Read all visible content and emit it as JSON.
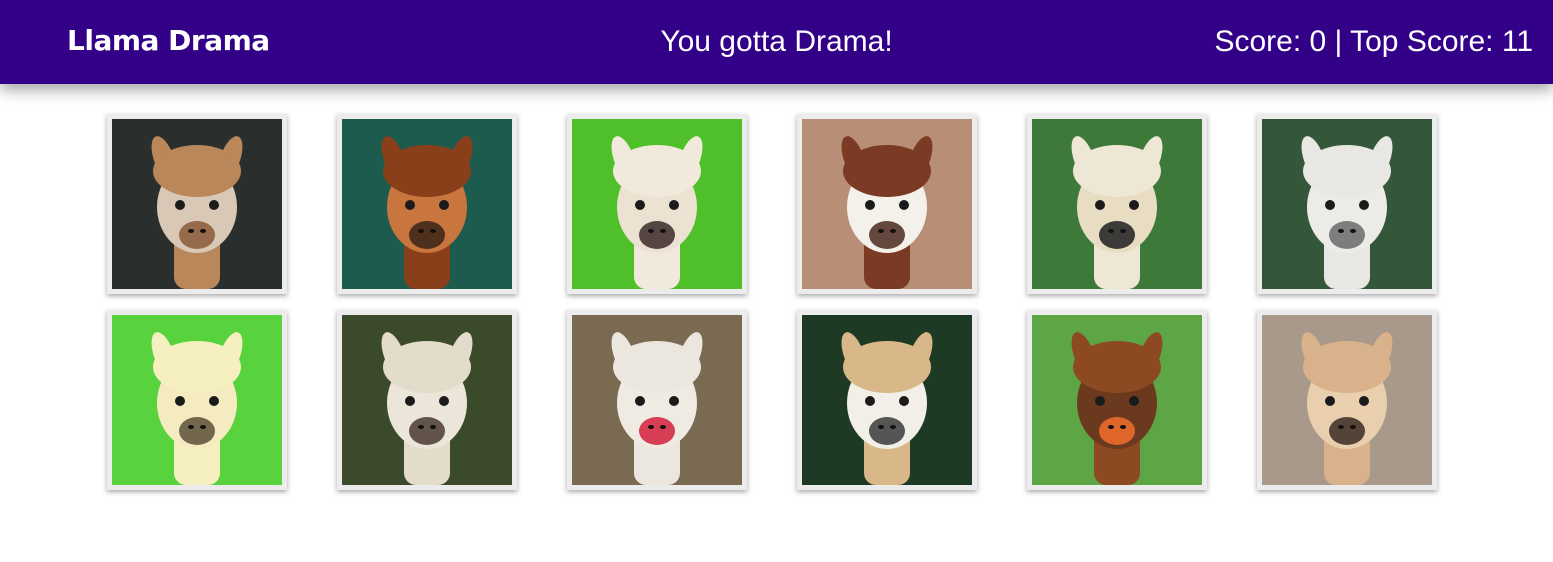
{
  "navbar": {
    "brand": "Llama Drama",
    "message": "You gotta Drama!",
    "score_label": "Score: 0 | Top Score: 11"
  },
  "cards": [
    {
      "name": "llama-card-1",
      "bg": "#2a2f2d",
      "wool": "#b9875a",
      "face": "#d8c8b5",
      "accent": "#8a5a38"
    },
    {
      "name": "llama-card-2",
      "bg": "#1d5b4e",
      "wool": "#8a3f1b",
      "face": "#c8763e",
      "accent": "#3a2418"
    },
    {
      "name": "llama-card-3",
      "bg": "#4fbf2a",
      "wool": "#f1e9dc",
      "face": "#ebe2d2",
      "accent": "#3b2a2c"
    },
    {
      "name": "llama-card-4",
      "bg": "#b88f76",
      "wool": "#7b3a24",
      "face": "#f4f0ea",
      "accent": "#4a2a1f"
    },
    {
      "name": "llama-card-5",
      "bg": "#3d7a3a",
      "wool": "#efe7d6",
      "face": "#e8dcc2",
      "accent": "#1e1e1e"
    },
    {
      "name": "llama-card-6",
      "bg": "#34573a",
      "wool": "#e9e7e3",
      "face": "#ecebe8",
      "accent": "#6a6a6a"
    },
    {
      "name": "llama-card-7",
      "bg": "#58d33e",
      "wool": "#f6efc0",
      "face": "#f4ecc0",
      "accent": "#5a5038"
    },
    {
      "name": "llama-card-8",
      "bg": "#3b4a2a",
      "wool": "#e4dccb",
      "face": "#ece6da",
      "accent": "#4a3a30"
    },
    {
      "name": "llama-card-9",
      "bg": "#7a6a52",
      "wool": "#ece7de",
      "face": "#efeae2",
      "accent": "#d21f3c"
    },
    {
      "name": "llama-card-10",
      "bg": "#1f3a24",
      "wool": "#d8b789",
      "face": "#f2efe9",
      "accent": "#3a3a3a"
    },
    {
      "name": "llama-card-11",
      "bg": "#5ea546",
      "wool": "#8d4a22",
      "face": "#6b3a1e",
      "accent": "#f36f2e"
    },
    {
      "name": "llama-card-12",
      "bg": "#a8998a",
      "wool": "#d9b28b",
      "face": "#e9cfae",
      "accent": "#3a2a22"
    }
  ]
}
